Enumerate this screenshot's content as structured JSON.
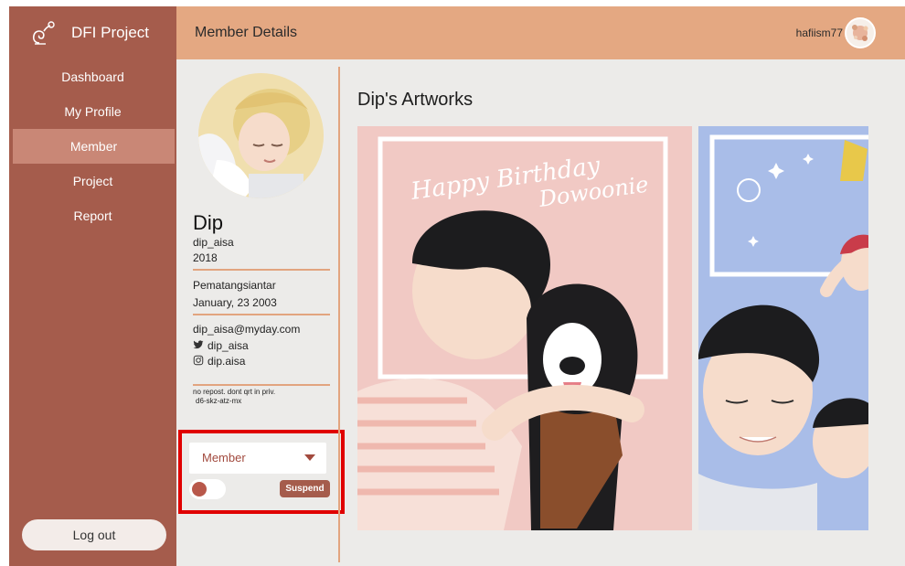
{
  "app": {
    "title": "DFI Project"
  },
  "sidebar": {
    "items": [
      {
        "label": "Dashboard",
        "active": false
      },
      {
        "label": "My Profile",
        "active": false
      },
      {
        "label": "Member",
        "active": true
      },
      {
        "label": "Project",
        "active": false
      },
      {
        "label": "Report",
        "active": false
      }
    ],
    "logout_label": "Log out"
  },
  "header": {
    "title": "Member Details",
    "username": "hafiism77"
  },
  "profile": {
    "name": "Dip",
    "handle": "dip_aisa",
    "year": "2018",
    "city": "Pematangsiantar",
    "birthdate": "January, 23 2003",
    "email": "dip_aisa@myday.com",
    "twitter": "dip_aisa",
    "instagram": "dip.aisa",
    "note_line1": "no repost. dont qrt in priv.",
    "note_line2": "d6-skz-atz-mx"
  },
  "controls": {
    "role_selected": "Member",
    "suspend_label": "Suspend",
    "toggle_on": false
  },
  "artworks": {
    "heading": "Dip's Artworks",
    "art1_caption_1": "Happy Birthday",
    "art1_caption_2": "Dowoonie"
  },
  "colors": {
    "sidebar": "#a55c4c",
    "header": "#e4a882",
    "accent_rule": "#e2a47f",
    "highlight_box": "#e00000"
  },
  "icons": [
    "brand-logo-icon",
    "twitter-icon",
    "instagram-icon",
    "caret-down-icon",
    "user-avatar"
  ]
}
